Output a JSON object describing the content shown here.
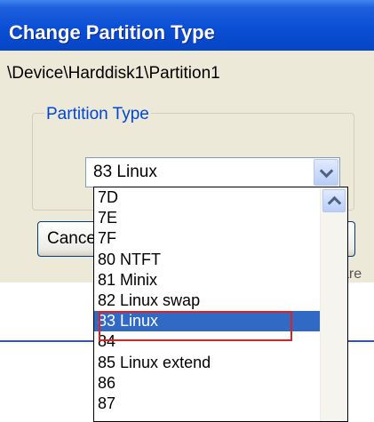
{
  "dialog": {
    "title": "Change Partition Type",
    "device_path": "\\Device\\Harddisk1\\Partition1",
    "group_label": "Partition Type",
    "combo_value": "83 Linux",
    "cancel_label": "Cancel"
  },
  "background": {
    "partial_text": "are"
  },
  "dropdown": {
    "items": [
      "7D",
      "7E",
      "7F",
      "80 NTFT",
      "81 Minix",
      "82 Linux swap",
      "83 Linux",
      "84",
      "85 Linux extend",
      "86",
      "87"
    ],
    "selected": "83 Linux"
  },
  "colors": {
    "title_bar": "#0a4fd6",
    "selection": "#316ac5",
    "highlight_box": "#e02020",
    "group_label": "#0046d5"
  }
}
